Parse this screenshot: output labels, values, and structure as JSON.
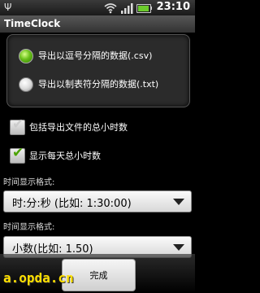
{
  "status_bar": {
    "time": "23:10",
    "icons": [
      "usb-icon",
      "wifi-icon",
      "signal-icon",
      "battery-icon"
    ]
  },
  "app": {
    "title": "TimeClock"
  },
  "export_format": {
    "options": [
      {
        "label": "导出以逗号分隔的数据(.csv)",
        "checked": true
      },
      {
        "label": "导出以制表符分隔的数据(.txt)",
        "checked": false
      }
    ]
  },
  "checkboxes": [
    {
      "label": "包括导出文件的总小时数",
      "checked": false
    },
    {
      "label": "显示每天总小时数",
      "checked": true
    }
  ],
  "time_format_1": {
    "label": "时间显示格式:",
    "value": "时:分:秒 (比如: 1:30:00)"
  },
  "time_format_2": {
    "label": "时间显示格式:",
    "value": "小数(比如: 1.50)"
  },
  "done_button": {
    "label": "完成"
  },
  "watermark": "a.opda.cn",
  "colors": {
    "accent_green": "#6ac01a",
    "background": "#000000",
    "watermark_yellow": "#ffe000"
  }
}
